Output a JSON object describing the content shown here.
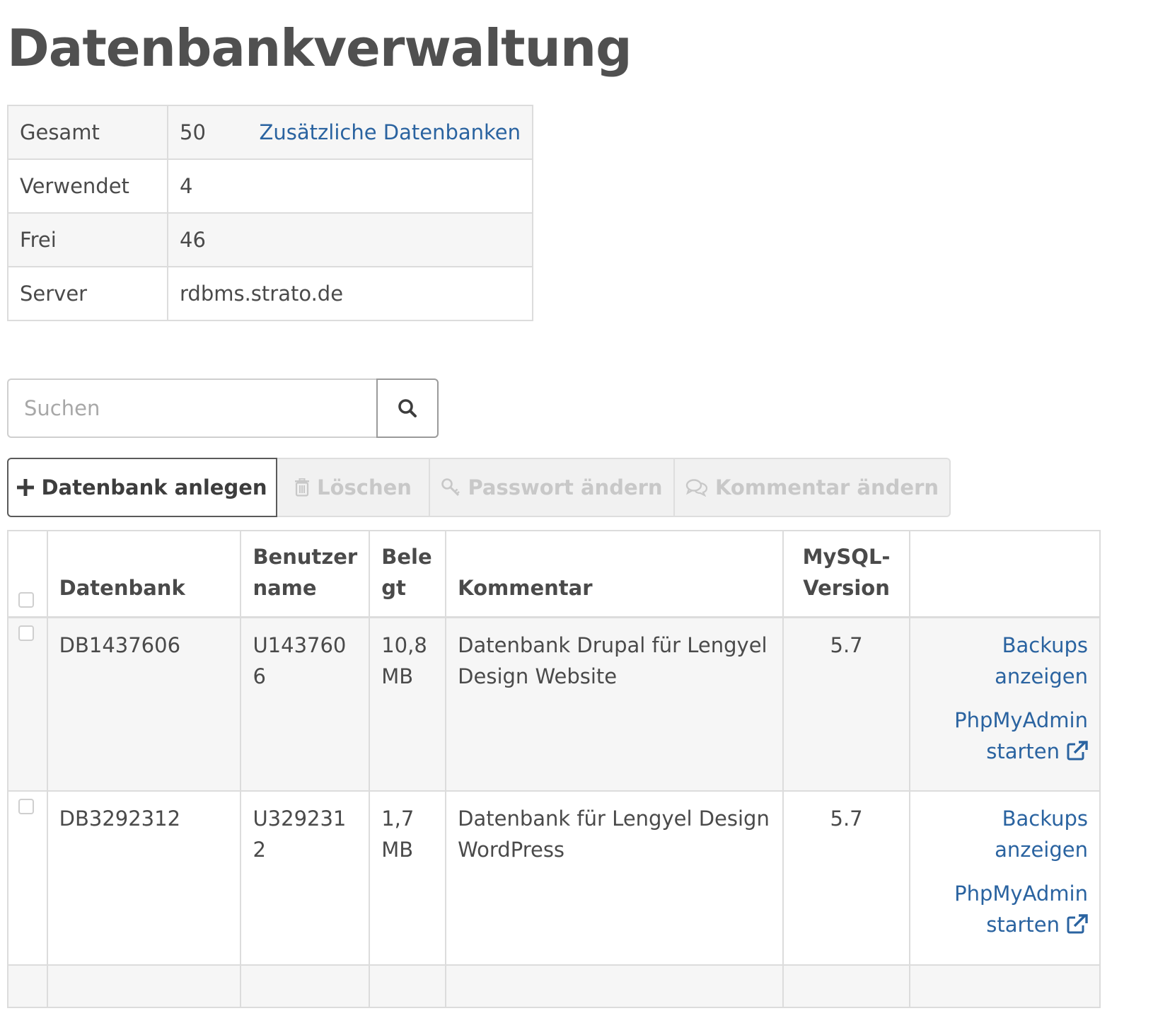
{
  "page": {
    "title": "Datenbankverwaltung"
  },
  "summary": {
    "rows": [
      {
        "label": "Gesamt",
        "value": "50",
        "link": "Zusätzliche Datenbanken"
      },
      {
        "label": "Verwendet",
        "value": "4"
      },
      {
        "label": "Frei",
        "value": "46"
      },
      {
        "label": "Server",
        "value": "rdbms.strato.de"
      }
    ]
  },
  "search": {
    "placeholder": "Suchen",
    "icon": "search-icon"
  },
  "toolbar": {
    "create_label": "Datenbank anlegen",
    "delete_label": "Löschen",
    "password_label": "Passwort ändern",
    "comment_label": "Kommentar ändern",
    "icons": {
      "create": "plus-icon",
      "delete": "trash-icon",
      "password": "key-icon",
      "comment": "comments-icon"
    }
  },
  "table": {
    "headers": {
      "database": "Datenbank",
      "username_1": "Benutzer",
      "username_2": "name",
      "size_1": "Bele",
      "size_2": "gt",
      "comment": "Kommentar",
      "version_1": "MySQL-",
      "version_2": "Version"
    },
    "rows": [
      {
        "database": "DB1437606",
        "username_1": "U143760",
        "username_2": "6",
        "size_1": "10,8",
        "size_2": "MB",
        "comment": "Datenbank Drupal für Lengyel Design Website",
        "version": "5.7",
        "backups_1": "Backups",
        "backups_2": "anzeigen",
        "pma_1": "PhpMyAdmin",
        "pma_2": "starten"
      },
      {
        "database": "DB3292312",
        "username_1": "U329231",
        "username_2": "2",
        "size_1": "1,7",
        "size_2": "MB",
        "comment": "Datenbank für Lengyel Design WordPress",
        "version": "5.7",
        "backups_1": "Backups",
        "backups_2": "anzeigen",
        "pma_1": "PhpMyAdmin",
        "pma_2": "starten"
      }
    ]
  },
  "colors": {
    "link": "#2a63a0",
    "text": "#4a4a4a",
    "border": "#dcdcdc",
    "stripe": "#f6f6f6",
    "disabled_text": "#c8c8c8"
  }
}
